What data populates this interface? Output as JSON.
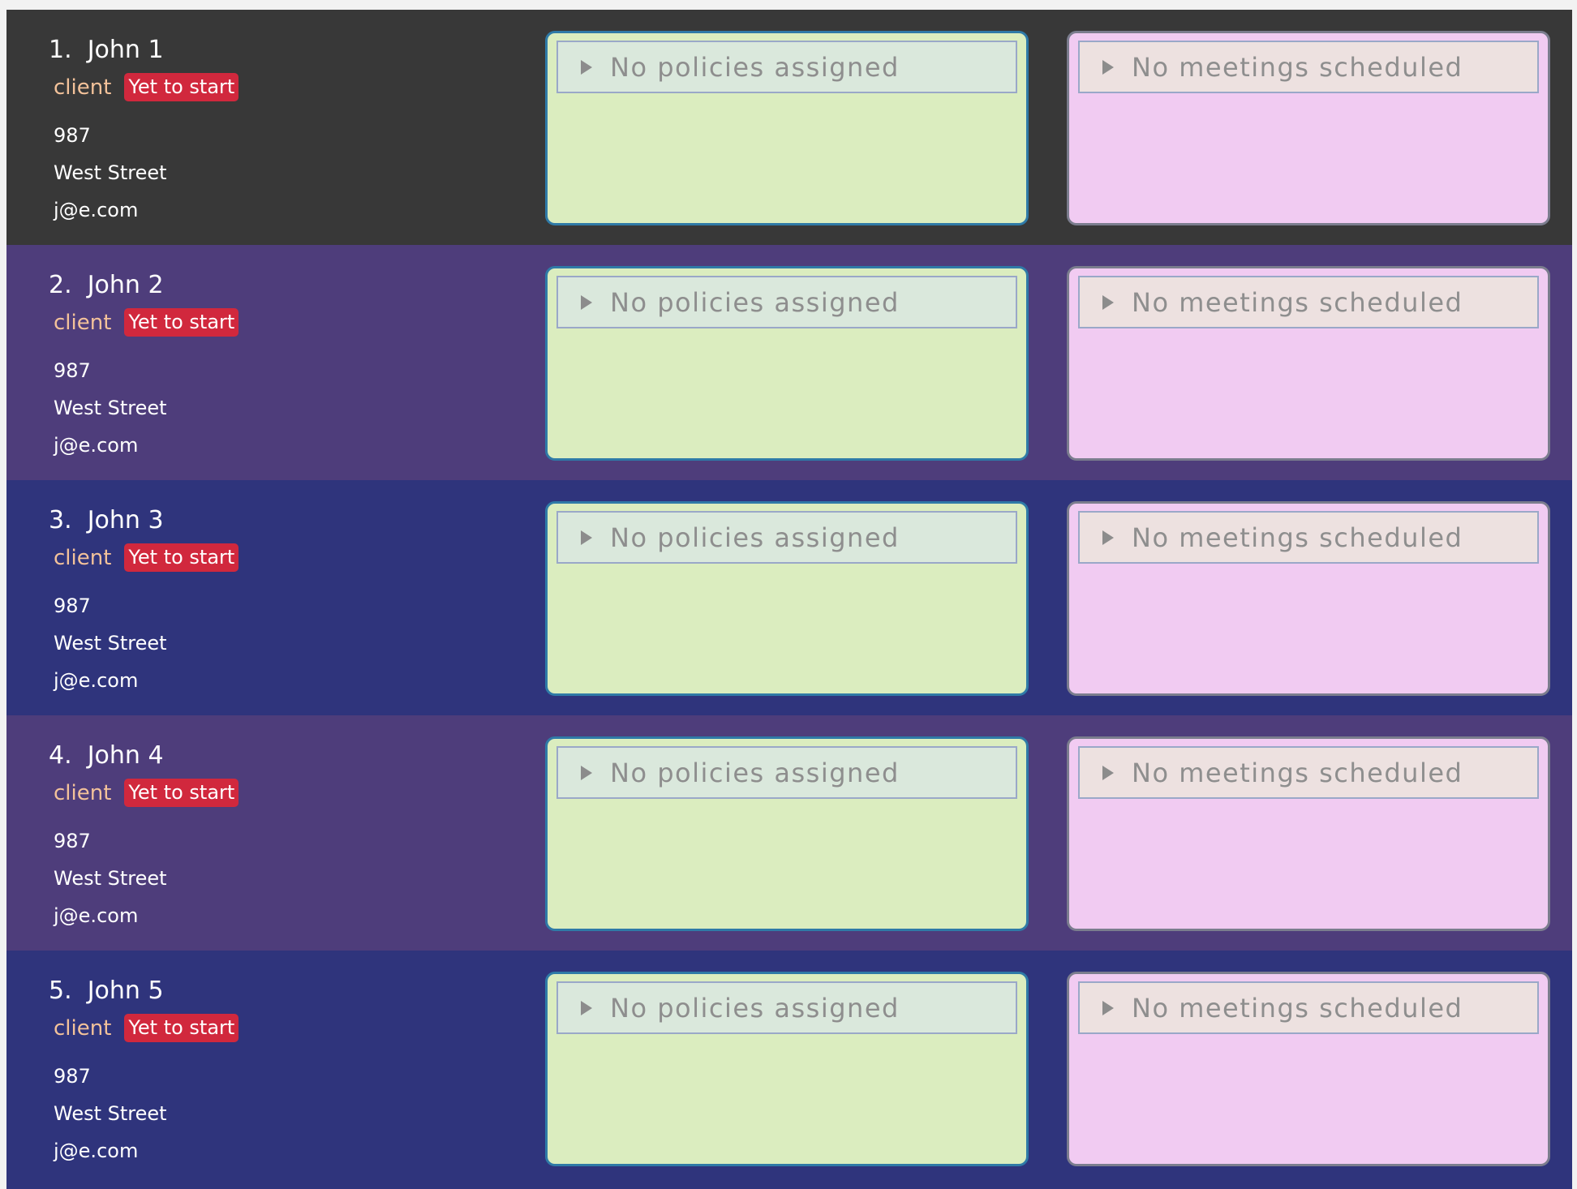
{
  "colors": {
    "row_dark": "#383838",
    "row_purple": "#4e3d7b",
    "row_blue": "#2f347c",
    "tag_type_text": "#f3c29a",
    "tag_status_bg": "#d1283d",
    "policies_bg": "#dbedbf",
    "meetings_bg": "#f1cbf2"
  },
  "icons": {
    "expand": "triangle-right-icon"
  },
  "persons": [
    {
      "name": "1.  John 1",
      "tag_type": "client",
      "tag_status": "Yet to start",
      "phone": "987",
      "address": "West Street",
      "email": "j@e.com",
      "policies_label": "No policies assigned",
      "meetings_label": "No meetings scheduled",
      "row_color": "#383838"
    },
    {
      "name": "2.  John 2",
      "tag_type": "client",
      "tag_status": "Yet to start",
      "phone": "987",
      "address": "West Street",
      "email": "j@e.com",
      "policies_label": "No policies assigned",
      "meetings_label": "No meetings scheduled",
      "row_color": "#4e3d7b"
    },
    {
      "name": "3.  John 3",
      "tag_type": "client",
      "tag_status": "Yet to start",
      "phone": "987",
      "address": "West Street",
      "email": "j@e.com",
      "policies_label": "No policies assigned",
      "meetings_label": "No meetings scheduled",
      "row_color": "#2f347c"
    },
    {
      "name": "4.  John 4",
      "tag_type": "client",
      "tag_status": "Yet to start",
      "phone": "987",
      "address": "West Street",
      "email": "j@e.com",
      "policies_label": "No policies assigned",
      "meetings_label": "No meetings scheduled",
      "row_color": "#4e3d7b"
    },
    {
      "name": "5.  John 5",
      "tag_type": "client",
      "tag_status": "Yet to start",
      "phone": "987",
      "address": "West Street",
      "email": "j@e.com",
      "policies_label": "No policies assigned",
      "meetings_label": "No meetings scheduled",
      "row_color": "#2f347c"
    }
  ]
}
